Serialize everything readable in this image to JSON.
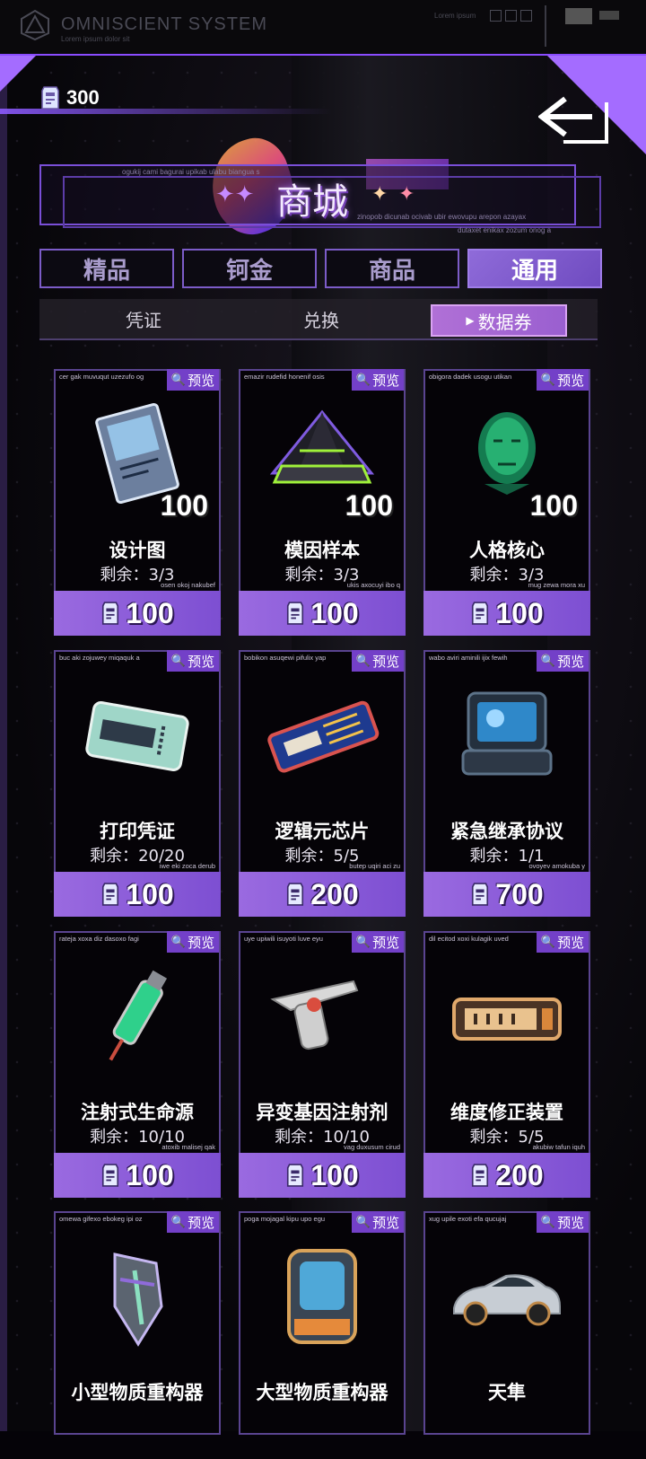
{
  "system": {
    "title": "OMNISCIENT SYSTEM",
    "subtitle": "Lorem ipsum dolor sit",
    "corner_text": "Lorem ipsum"
  },
  "currency": {
    "amount": "300",
    "icon": "data-ticket-icon"
  },
  "header": {
    "title": "商城",
    "deco_text_1": "ogukij cami bagurai upikab ulabu biangua s",
    "deco_text_2": "zinopob dicunab ocivab ubir ewovupu arepon azayax",
    "deco_text_3": "dutaxet enikax zozum onog a"
  },
  "tabs": [
    "精品",
    "钶金",
    "商品",
    "通用"
  ],
  "active_tab": 3,
  "subtabs": [
    "凭证",
    "兑换",
    "数据券"
  ],
  "active_subtab": 2,
  "preview_label": "预览",
  "remain_prefix": "剩余：",
  "items": [
    {
      "name": "设计图",
      "remain": "3/3",
      "qty": "100",
      "price": "100",
      "code_top": "cer gak muvuqut uzezufo og",
      "code_bottom": "osen okoj nakubef",
      "icon": "blueprint-icon"
    },
    {
      "name": "模因样本",
      "remain": "3/3",
      "qty": "100",
      "price": "100",
      "code_top": "emazir rudefid honenif osis",
      "code_bottom": "ukis axocuyi ibo q",
      "icon": "pyramid-icon"
    },
    {
      "name": "人格核心",
      "remain": "3/3",
      "qty": "100",
      "price": "100",
      "code_top": "obigora dadek usogu utikan",
      "code_bottom": "mug zewa mora xu",
      "icon": "hologram-head-icon"
    },
    {
      "name": "打印凭证",
      "remain": "20/20",
      "qty": "",
      "price": "100",
      "code_top": "buc aki zojuwey miqaquk a",
      "code_bottom": "iwe eki zoca derub",
      "icon": "print-ticket-icon"
    },
    {
      "name": "逻辑元芯片",
      "remain": "5/5",
      "qty": "",
      "price": "200",
      "code_top": "bobikon asuqewi pifulix yap",
      "code_bottom": "butep uqiri aci zu",
      "icon": "chip-card-icon"
    },
    {
      "name": "紧急继承协议",
      "remain": "1/1",
      "qty": "",
      "price": "700",
      "code_top": "wabo aviri aminili ijix fewih",
      "code_bottom": "ovoyev amokuba y",
      "icon": "device-case-icon"
    },
    {
      "name": "注射式生命源",
      "remain": "10/10",
      "qty": "",
      "price": "100",
      "code_top": "rateja xoxa diz dasoxo fagi",
      "code_bottom": "atoxib malisej qak",
      "icon": "syringe-icon"
    },
    {
      "name": "异变基因注射剂",
      "remain": "10/10",
      "qty": "",
      "price": "100",
      "code_top": "uye upiwili isuyoti luve eyu",
      "code_bottom": "vag duxusum cirud",
      "icon": "injector-gun-icon"
    },
    {
      "name": "维度修正装置",
      "remain": "5/5",
      "qty": "",
      "price": "200",
      "code_top": "dil ecitod xoxi kulagik uved",
      "code_bottom": "akubiw tafun iquh",
      "icon": "counter-device-icon"
    },
    {
      "name": "小型物质重构器",
      "remain": "",
      "qty": "",
      "price": "",
      "code_top": "omewa gifexo ebokeg ipi oz",
      "code_bottom": "",
      "icon": "small-reconstructor-icon"
    },
    {
      "name": "大型物质重构器",
      "remain": "",
      "qty": "",
      "price": "",
      "code_top": "poga mojagal kipu upo egu",
      "code_bottom": "",
      "icon": "large-reconstructor-icon"
    },
    {
      "name": "天隼",
      "remain": "",
      "qty": "",
      "price": "",
      "code_top": "xug upile exoti efa qucujaj",
      "code_bottom": "",
      "icon": "sports-car-icon"
    }
  ],
  "colors": {
    "accent": "#8a4cff",
    "button": "#8f62dc",
    "preview": "#7340c8"
  }
}
